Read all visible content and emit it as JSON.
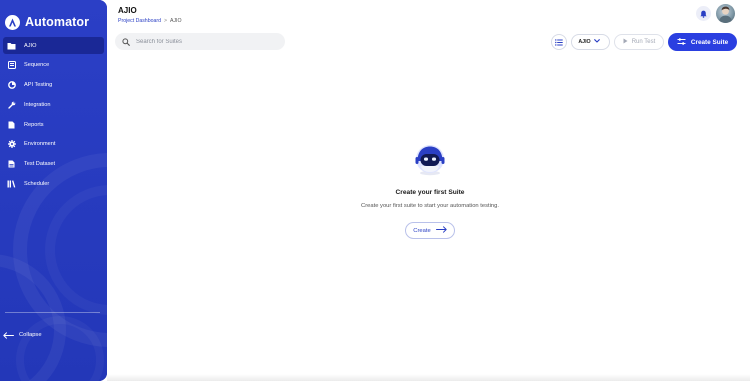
{
  "app": {
    "brand_name": "Automator"
  },
  "sidebar": {
    "items": [
      {
        "label": "AJIO",
        "icon": "folder-icon",
        "active": true
      },
      {
        "label": "Sequence",
        "icon": "sequence-icon",
        "active": false
      },
      {
        "label": "API Testing",
        "icon": "api-icon",
        "active": false
      },
      {
        "label": "Integration",
        "icon": "wrench-icon",
        "active": false
      },
      {
        "label": "Reports",
        "icon": "report-icon",
        "active": false
      },
      {
        "label": "Environment",
        "icon": "gear-icon",
        "active": false
      },
      {
        "label": "Test Dataset",
        "icon": "dataset-icon",
        "active": false
      },
      {
        "label": "Scheduler",
        "icon": "scheduler-icon",
        "active": false
      }
    ],
    "collapse_label": "Collapse"
  },
  "header": {
    "title": "AJIO",
    "breadcrumb": {
      "link": "Project Dashboard",
      "separator": ">",
      "current": "AJIO"
    }
  },
  "toolbar": {
    "search_placeholder": "Search for Suites",
    "project_select_value": "AJIO",
    "run_test_label": "Run Test",
    "create_suite_label": "Create Suite"
  },
  "empty_state": {
    "title": "Create your first Suite",
    "description": "Create your first suite to start your automation testing.",
    "button_label": "Create"
  },
  "colors": {
    "sidebar_bg": "#2a3fc4",
    "sidebar_active": "#1a2896",
    "primary": "#2a3fe0"
  }
}
